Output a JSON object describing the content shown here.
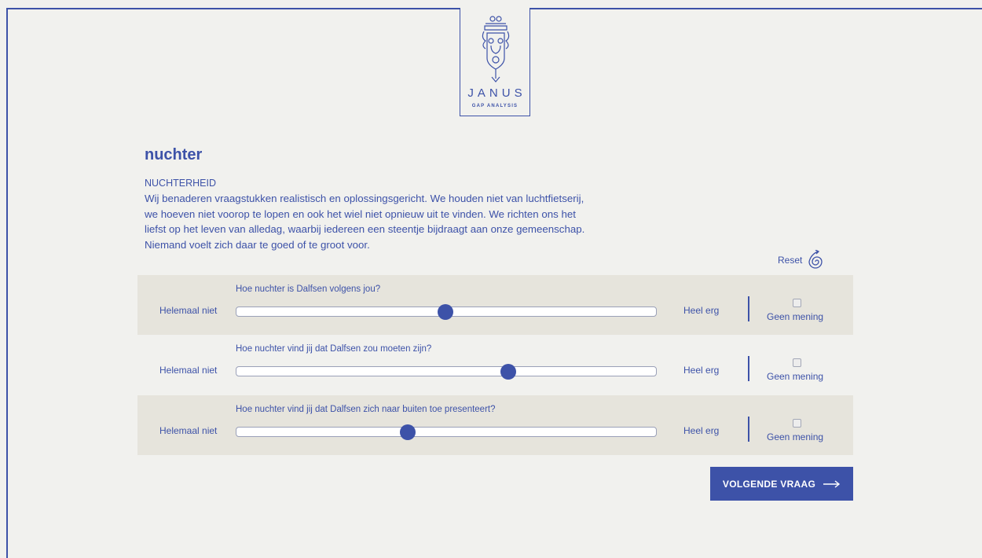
{
  "logo": {
    "brand": "JANUS",
    "sub": "GAP ANALYSIS",
    "emblem_icon": "janus-emblem-icon"
  },
  "page": {
    "title": "nuchter",
    "heading": "NUCHTERHEID",
    "description_lines": [
      "Wij benaderen vraagstukken realistisch en oplossingsgericht. We houden niet van luchtfietserij,",
      "we hoeven niet voorop te lopen en ook het wiel niet opnieuw uit te vinden. We richten ons het",
      "liefst op het leven van alledag, waarbij iedereen een steentje bijdraagt aan onze gemeenschap.",
      "Niemand voelt zich daar te goed of te groot voor."
    ]
  },
  "reset": {
    "label": "Reset",
    "icon": "reset-spiral-icon"
  },
  "questions": [
    {
      "question": "Hoe nuchter is Dalfsen volgens jou?",
      "min_label": "Helemaal niet",
      "max_label": "Heel erg",
      "value": 0.5,
      "no_opinion": "Geen mening",
      "no_opinion_checked": false
    },
    {
      "question": "Hoe nuchter vind jij dat Dalfsen zou moeten zijn?",
      "min_label": "Helemaal niet",
      "max_label": "Heel erg",
      "value": 0.65,
      "no_opinion": "Geen mening",
      "no_opinion_checked": false
    },
    {
      "question": "Hoe nuchter vind jij dat Dalfsen zich naar buiten toe presenteert?",
      "min_label": "Helemaal niet",
      "max_label": "Heel erg",
      "value": 0.41,
      "no_opinion": "Geen mening",
      "no_opinion_checked": false
    }
  ],
  "next_button": {
    "label": "VOLGENDE VRAAG",
    "icon": "arrow-right-icon"
  },
  "colors": {
    "accent": "#3d52a8",
    "background": "#f1f1ee",
    "row_band": "#e6e4dc"
  }
}
